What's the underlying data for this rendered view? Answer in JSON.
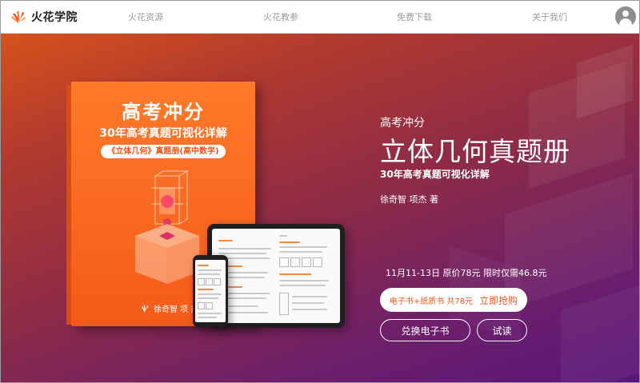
{
  "brand": {
    "name": "火花学院",
    "accent": "#f0561a"
  },
  "nav": {
    "items": [
      {
        "label": "火花资源"
      },
      {
        "label": "火花教参"
      },
      {
        "label": "免费下载"
      },
      {
        "label": "关于我们"
      }
    ],
    "avatar_icon": "user-avatar-icon"
  },
  "book_cover": {
    "title": "高考冲分",
    "subtitle": "30年高考真题可视化详解",
    "tag": "《立体几何》真题册(高中数学)",
    "authors": "徐奇智  项 杰 / 著"
  },
  "hero": {
    "eyebrow": "高考冲分",
    "title": "立体几何真题册",
    "subtitle": "30年高考真题可视化详解",
    "authors": "徐奇智 项杰 著",
    "promo": "11月11-13日 原价78元 限时仅需46.8元",
    "buy_combo_label": "电子书+纸质书 共78元",
    "buy_now_label": "立即抢购",
    "redeem_label": "兑换电子书",
    "trial_label": "试读",
    "colors": {
      "gradient_top": "#d6521c",
      "gradient_bottom": "#5a157a",
      "book_orange": "#f45a17"
    }
  }
}
